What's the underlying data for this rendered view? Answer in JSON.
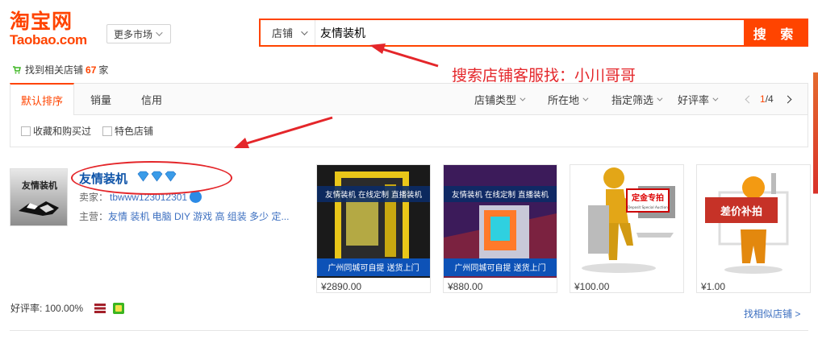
{
  "header": {
    "logo_cn": "淘宝网",
    "logo_en": "Taobao.com",
    "more_market": "更多市场"
  },
  "search": {
    "type": "店铺",
    "query": "友情装机",
    "button": "搜 索"
  },
  "result": {
    "prefix": "找到相关店铺",
    "count": "67",
    "suffix": "家"
  },
  "annotation": "搜索店铺客服找：小川哥哥",
  "sortbar": {
    "tabs": [
      "默认排序",
      "销量",
      "信用"
    ],
    "filters": [
      "店铺类型",
      "所在地",
      "指定筛选",
      "好评率"
    ],
    "page_current": "1",
    "page_total": "/4"
  },
  "checks": [
    "收藏和购买过",
    "特色店铺"
  ],
  "shop": {
    "logo_text": "友情装机",
    "name": "友情装机",
    "seller_label": "卖家：",
    "seller_name": "tbwww123012301",
    "main_label": "主营：",
    "main_biz": "友情 装机 电脑 DIY 游戏 高 组装 多少 定...",
    "rating": "好评率: 100.00%",
    "similar": "找相似店铺 >"
  },
  "products": [
    {
      "banner": "友情装机 在线定制 直播装机",
      "footer": "广州同城可自提 送货上门",
      "price": "¥2890.00"
    },
    {
      "banner": "友情装机 在线定制 直播装机",
      "footer": "广州同城可自提 送货上门",
      "price": "¥880.00"
    },
    {
      "sign": "定金专拍",
      "sign_sub": "Deposit Special Auction",
      "price": "¥100.00"
    },
    {
      "sign": "差价补拍",
      "price": "¥1.00"
    }
  ],
  "colors": {
    "brand": "#ff4400",
    "link": "#0d53a8",
    "annotation": "#e4262a"
  }
}
